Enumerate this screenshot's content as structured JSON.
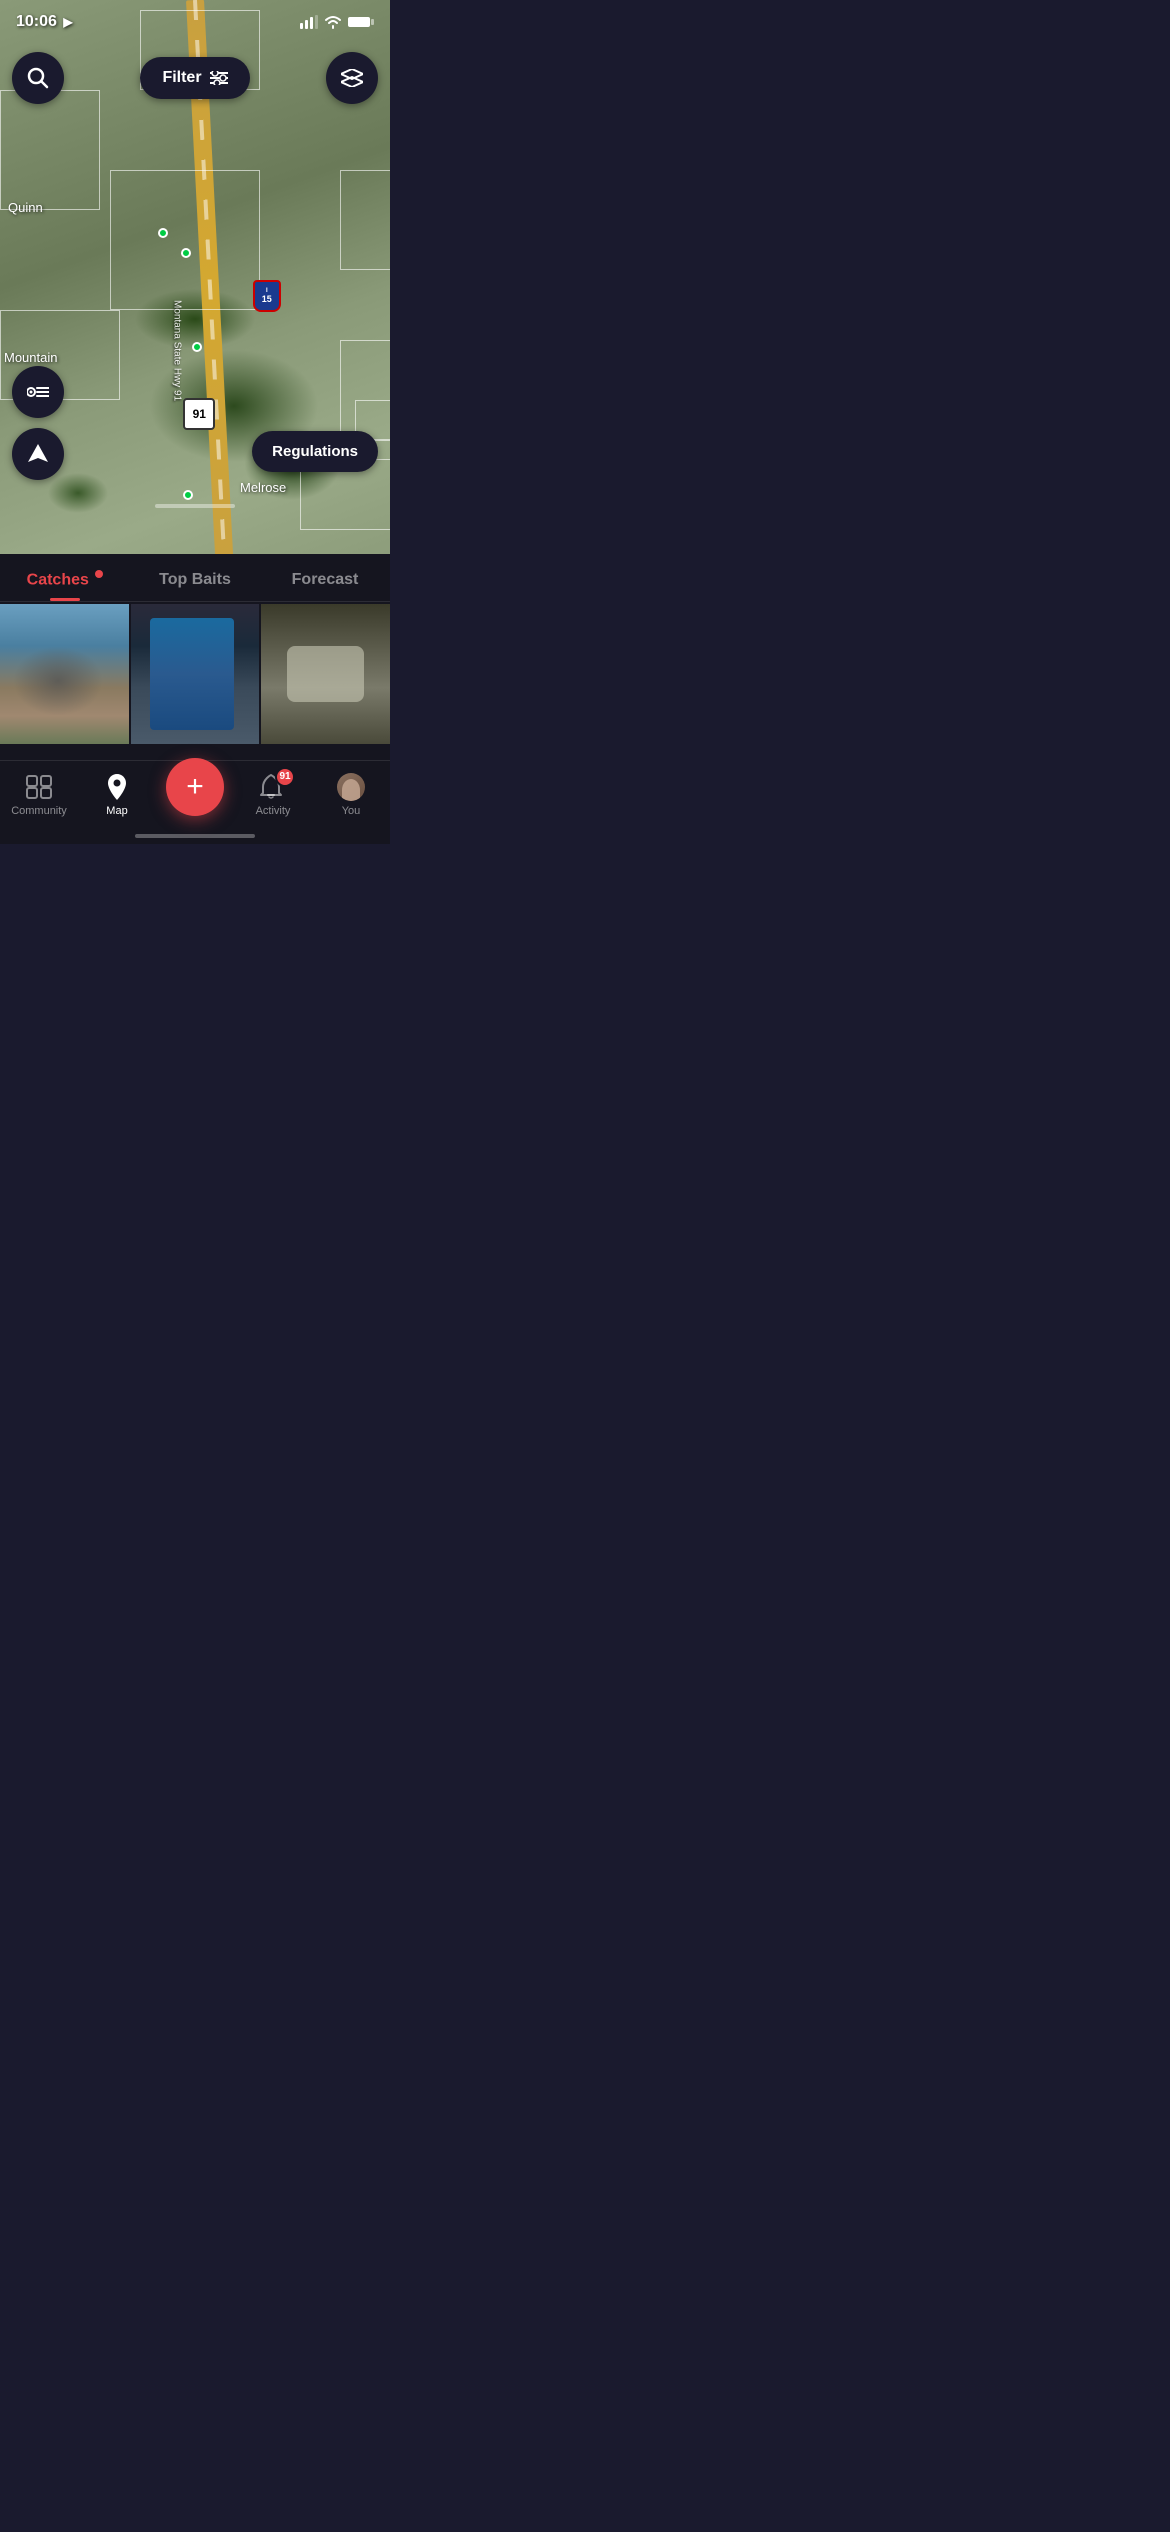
{
  "statusBar": {
    "time": "10:06",
    "timeIcon": "location-arrow-icon"
  },
  "mapControls": {
    "searchLabel": "🔍",
    "filterLabel": "Filter",
    "filterIcon": "⚙",
    "layersLabel": "⊞",
    "listLabel": "≡",
    "locationLabel": "▶",
    "regulationsLabel": "Regulations"
  },
  "mapLabels": {
    "quinn": "Quinn",
    "mountain": "Mountain",
    "melrose": "Melrose",
    "hwy": "Montana State Hwy 91",
    "shield91": "91",
    "shieldI15": "15"
  },
  "tabs": {
    "catches": "Catches",
    "topBaits": "Top Baits",
    "forecast": "Forecast"
  },
  "nav": {
    "community": "Community",
    "map": "Map",
    "add": "+",
    "activity": "Activity",
    "you": "You",
    "activityBadge": "91"
  }
}
